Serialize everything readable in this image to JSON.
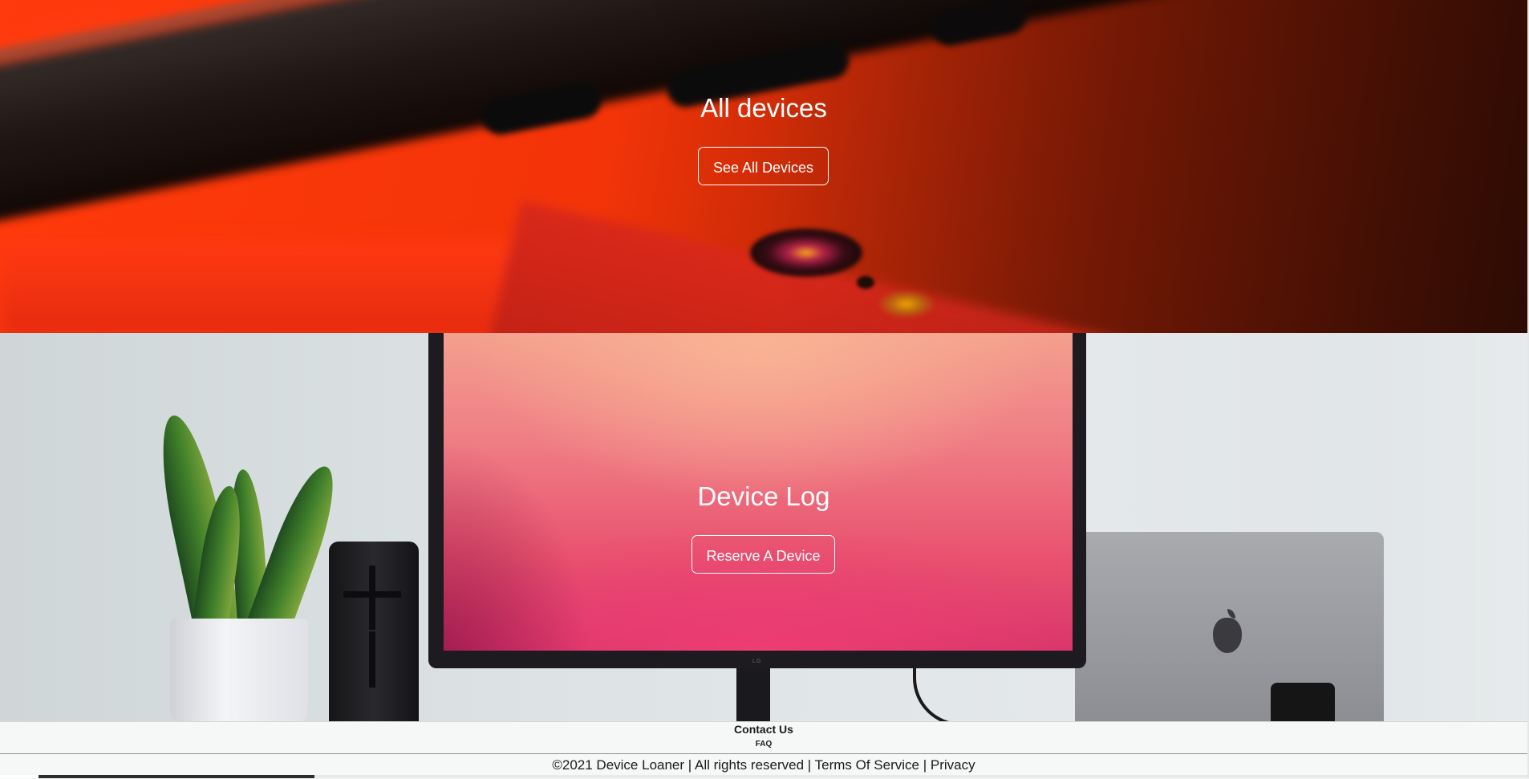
{
  "hero_all_devices": {
    "title": "All devices",
    "button_label": "See All Devices"
  },
  "hero_device_log": {
    "title": "Device Log",
    "button_label": "Reserve A Device"
  },
  "footer": {
    "contact_label": "Contact Us",
    "faq_label": "FAQ",
    "copyright": "©2021 Device Loaner",
    "rights": "All rights reserved",
    "terms_label": "Terms Of Service",
    "privacy_label": "Privacy",
    "separator": "|"
  },
  "monitor_brand": "LG",
  "colors": {
    "hero1_accent": "#ff3a0a",
    "screen_pink": "#e9536f",
    "footer_bg": "#f6f8f8"
  }
}
